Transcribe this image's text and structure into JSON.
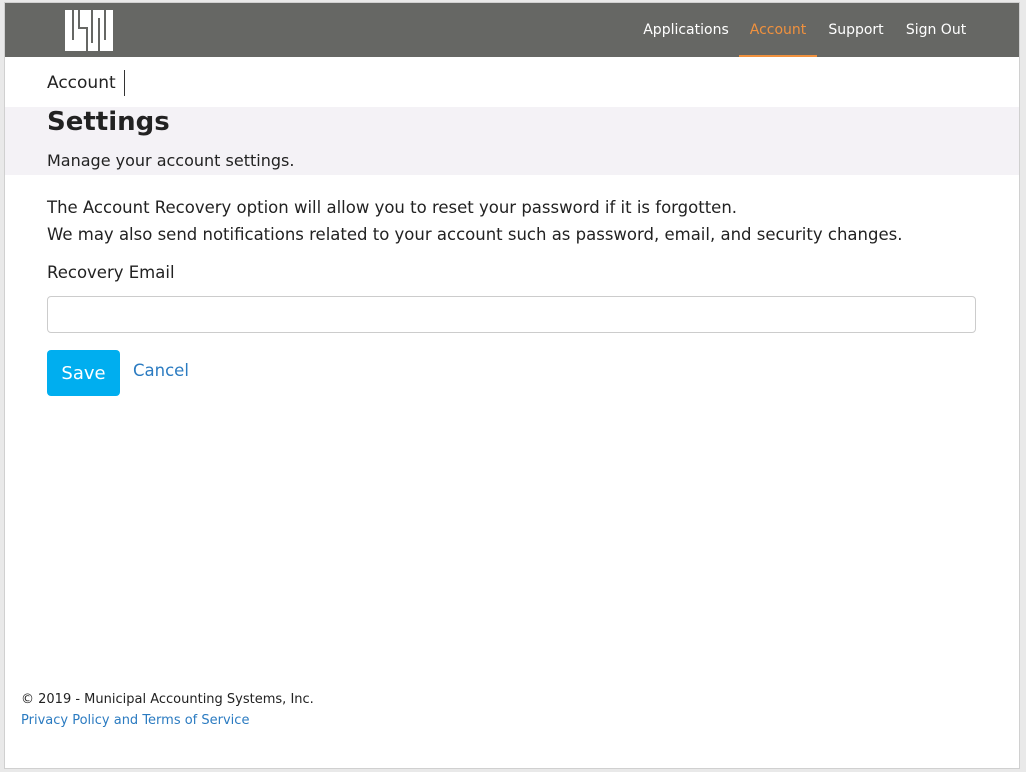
{
  "nav": {
    "logo_name": "logo-icon",
    "items": [
      {
        "label": "Applications",
        "active": false
      },
      {
        "label": "Account",
        "active": true
      },
      {
        "label": "Support",
        "active": false
      },
      {
        "label": "Sign Out",
        "active": false
      }
    ]
  },
  "breadcrumb": "Account",
  "header": {
    "title": "Settings",
    "subtitle": "Manage your account settings."
  },
  "description": {
    "line1": "The Account Recovery option will allow you to reset your password if it is forgotten.",
    "line2": "We may also send notifications related to your account such as password, email, and security changes."
  },
  "form": {
    "recovery_label": "Recovery Email",
    "recovery_value": "",
    "save_label": "Save",
    "cancel_label": "Cancel"
  },
  "footer": {
    "copyright": "© 2019 - Municipal Accounting Systems, Inc.",
    "privacy_link": "Privacy Policy and Terms of Service"
  },
  "colors": {
    "navbar_bg": "#666764",
    "nav_active": "#f0913e",
    "header_band": "#f4f2f6",
    "primary_button": "#00aeef",
    "link": "#2b7bc1"
  }
}
